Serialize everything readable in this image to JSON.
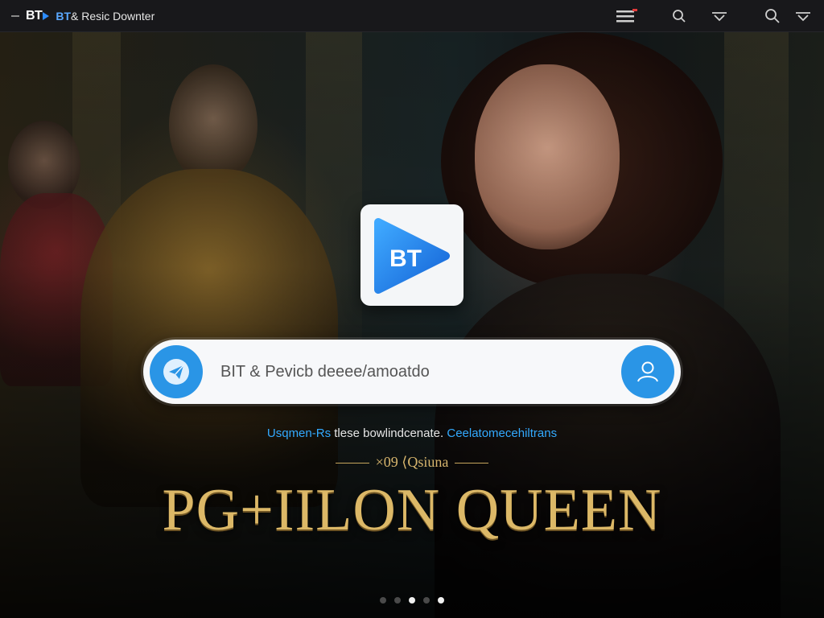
{
  "header": {
    "brand_mark": "BT",
    "brand_accent": "BT",
    "brand_name": "& Resic Downter",
    "icons": [
      "menu-icon",
      "search-icon",
      "chevron-down-icon",
      "search-icon",
      "chevron-down-icon"
    ]
  },
  "hero": {
    "logo_text": "BT",
    "search": {
      "placeholder": "BIT & Pevicb deeee/amoatdo"
    },
    "subline": {
      "part1": "Usqmen-Rs",
      "part2": "tlese bowlindcenate.",
      "part3": "Ceelatomecehiltrans"
    },
    "eyebrow": "×09 ⟨Qsiuna",
    "title": "PG+IILON QUEEN",
    "pager": {
      "count": 5,
      "active_indices": [
        2,
        4
      ]
    }
  },
  "colors": {
    "accent": "#2a95e6",
    "title_gold": "#dcb867",
    "topbar": "#18181b"
  }
}
